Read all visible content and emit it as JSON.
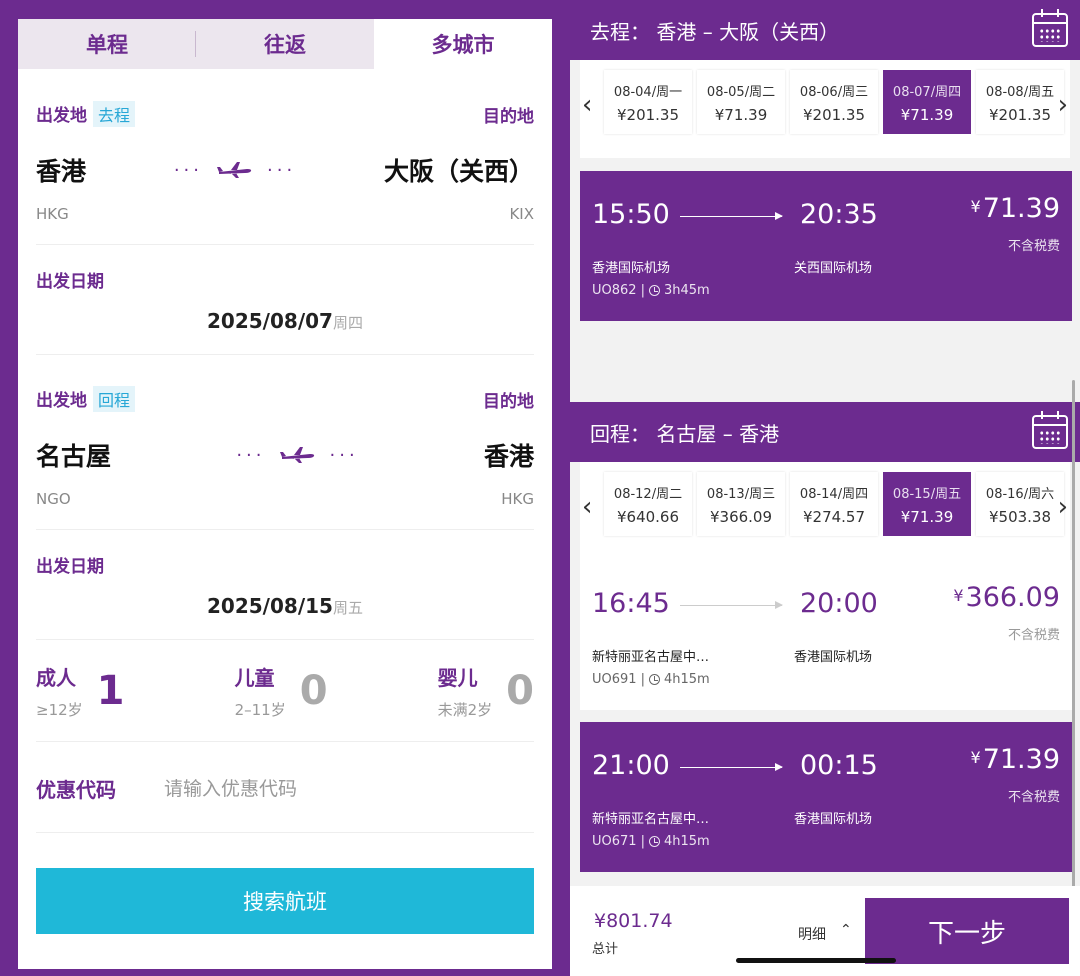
{
  "tabs": [
    "单程",
    "往返",
    "多城市"
  ],
  "outbound": {
    "origin_label": "出发地",
    "tag": "去程",
    "dest_label": "目的地",
    "origin_city": "香港",
    "dest_city": "大阪（关西）",
    "origin_code": "HKG",
    "dest_code": "KIX",
    "date_label": "出发日期",
    "date": "2025/08/07",
    "weekday": "周四"
  },
  "return": {
    "origin_label": "出发地",
    "tag": "回程",
    "dest_label": "目的地",
    "origin_city": "名古屋",
    "dest_city": "香港",
    "origin_code": "NGO",
    "dest_code": "HKG",
    "date_label": "出发日期",
    "date": "2025/08/15",
    "weekday": "周五"
  },
  "passengers": {
    "adult": {
      "label": "成人",
      "sub": "≥12岁",
      "count": "1"
    },
    "child": {
      "label": "儿童",
      "sub": "2–11岁",
      "count": "0"
    },
    "infant": {
      "label": "婴儿",
      "sub": "未满2岁",
      "count": "0"
    }
  },
  "promo": {
    "label": "优惠代码",
    "placeholder": "请输入优惠代码"
  },
  "search_label": "搜索航班",
  "right": {
    "out_header": "去程：  香港 – 大阪（关西）",
    "ret_header": "回程：  名古屋 – 香港",
    "out_dates": [
      {
        "d": "08-04/周一",
        "p": "¥201.35"
      },
      {
        "d": "08-05/周二",
        "p": "¥71.39"
      },
      {
        "d": "08-06/周三",
        "p": "¥201.35"
      },
      {
        "d": "08-07/周四",
        "p": "¥71.39"
      },
      {
        "d": "08-08/周五",
        "p": "¥201.35"
      }
    ],
    "ret_dates": [
      {
        "d": "08-12/周二",
        "p": "¥640.66"
      },
      {
        "d": "08-13/周三",
        "p": "¥366.09"
      },
      {
        "d": "08-14/周四",
        "p": "¥274.57"
      },
      {
        "d": "08-15/周五",
        "p": "¥71.39"
      },
      {
        "d": "08-16/周六",
        "p": "¥503.38"
      }
    ],
    "flights": [
      {
        "dep": "15:50",
        "arr": "20:35",
        "yen": "¥",
        "price": "71.39",
        "tax": "不含税费",
        "dep_ap": "香港国际机场",
        "arr_ap": "关西国际机场",
        "no": "UO862",
        "dur": "3h45m"
      },
      {
        "dep": "16:45",
        "arr": "20:00",
        "yen": "¥",
        "price": "366.09",
        "tax": "不含税费",
        "dep_ap": "新特丽亚名古屋中…",
        "arr_ap": "香港国际机场",
        "no": "UO691",
        "dur": "4h15m"
      },
      {
        "dep": "21:00",
        "arr": "00:15",
        "yen": "¥",
        "price": "71.39",
        "tax": "不含税费",
        "dep_ap": "新特丽亚名古屋中…",
        "arr_ap": "香港国际机场",
        "no": "UO671",
        "dur": "4h15m"
      }
    ],
    "total": "¥801.74",
    "total_label": "总计",
    "detail_label": "明细",
    "next_label": "下一步"
  },
  "colors": {
    "brand": "#6c2b8f",
    "accent": "#1fb8d8"
  }
}
